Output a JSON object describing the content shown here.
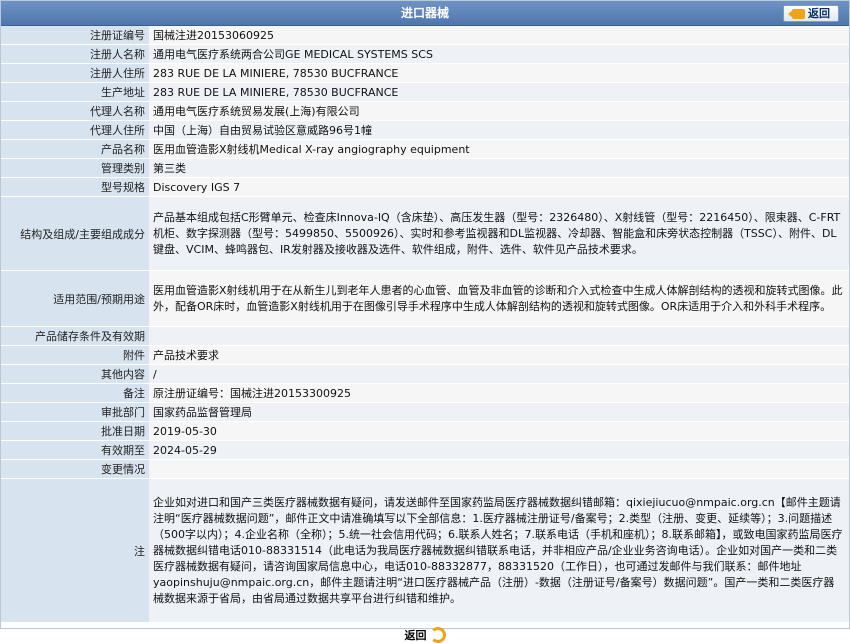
{
  "header": {
    "title": "进口器械",
    "back_label": "返回"
  },
  "rows": [
    {
      "label": "注册证编号",
      "value": "国械注进20153060925"
    },
    {
      "label": "注册人名称",
      "value": "通用电气医疗系统两合公司GE MEDICAL SYSTEMS SCS"
    },
    {
      "label": "注册人住所",
      "value": "283 RUE DE LA MINIERE, 78530 BUCFRANCE"
    },
    {
      "label": "生产地址",
      "value": "283 RUE DE LA MINIERE, 78530 BUCFRANCE"
    },
    {
      "label": "代理人名称",
      "value": "通用电气医疗系统贸易发展(上海)有限公司"
    },
    {
      "label": "代理人住所",
      "value": "中国（上海）自由贸易试验区意威路96号1幢"
    },
    {
      "label": "产品名称",
      "value": "医用血管造影X射线机Medical X-ray angiography equipment"
    },
    {
      "label": "管理类别",
      "value": "第三类"
    },
    {
      "label": "型号规格",
      "value": "Discovery IGS 7"
    },
    {
      "label": "结构及组成/主要组成成分",
      "value": "产品基本组成包括C形臂单元、检查床Innova-IQ（含床垫）、高压发生器（型号：2326480）、X射线管（型号：2216450）、限束器、C-FRT机柜、数字探测器（型号：5499850、5500926）、实时和参考监视器和DL监视器、冷却器、智能盒和床旁状态控制器（TSSC）、附件、DL键盘、VCIM、蜂鸣器包、IR发射器及接收器及选件、软件组成，附件、选件、软件见产品技术要求。"
    },
    {
      "label": "适用范围/预期用途",
      "value": "医用血管造影X射线机用于在从新生儿到老年人患者的心血管、血管及非血管的诊断和介入式检查中生成人体解剖结构的透视和旋转式图像。此外，配备OR床时，血管造影X射线机用于在图像引导手术程序中生成人体解剖结构的透视和旋转式图像。OR床适用于介入和外科手术程序。"
    },
    {
      "label": "产品储存条件及有效期",
      "value": ""
    },
    {
      "label": "附件",
      "value": "产品技术要求"
    },
    {
      "label": "其他内容",
      "value": "/"
    },
    {
      "label": "备注",
      "value": "原注册证编号：国械注进20153300925"
    },
    {
      "label": "审批部门",
      "value": "国家药品监督管理局"
    },
    {
      "label": "批准日期",
      "value": "2019-05-30"
    },
    {
      "label": "有效期至",
      "value": "2024-05-29"
    },
    {
      "label": "变更情况",
      "value": ""
    },
    {
      "label": "注",
      "value": "企业如对进口和国产三类医疗器械数据有疑问，请发送邮件至国家药监局医疗器械数据纠错邮箱：qixiejiucuo@nmpaic.org.cn【邮件主题请注明“医疗器械数据问题”，邮件正文中请准确填写以下全部信息：1.医疗器械注册证号/备案号；2.类型（注册、变更、延续等）；3.问题描述（500字以内）；4.企业名称（全称）；5.统一社会信用代码；6.联系人姓名；7.联系电话（手机和座机）；8.联系邮箱】，或致电国家药监局医疗器械数据纠错电话010-88331514（此电话为我局医疗器械数据纠错联系电话，并非相应产品/企业业务咨询电话）。企业如对国产一类和二类医疗器械数据有疑问，请咨询国家局信息中心，电话010-88332877，88331520（工作日），也可通过发邮件与我们联系：邮件地址yaopinshuju@nmpaic.org.cn，邮件主题请注明“进口医疗器械产品（注册）-数据（注册证号/备案号）数据问题”。国产一类和二类医疗器械数据来源于省局，由省局通过数据共享平台进行纠错和维护。"
    }
  ],
  "footer": {
    "back_label": "返回"
  }
}
